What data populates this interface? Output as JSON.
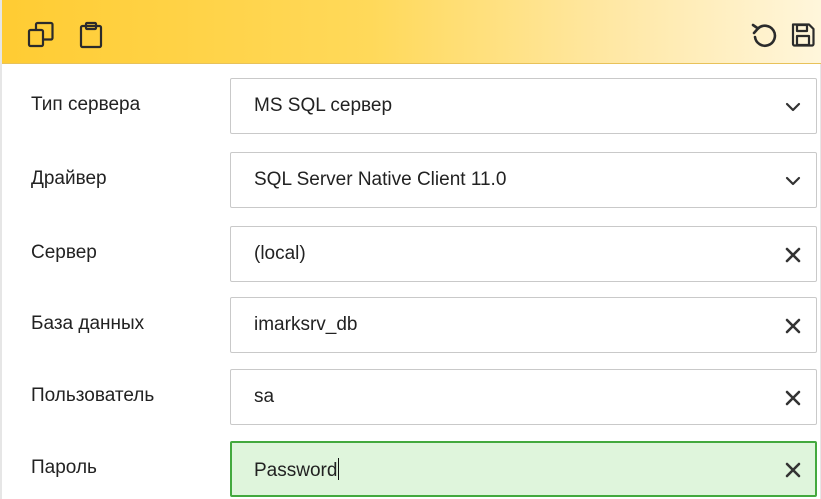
{
  "toolbar": {
    "left_icons": [
      "copy-icon",
      "paste-icon"
    ],
    "right_icons": [
      "undo-icon",
      "save-icon"
    ],
    "accent": "#ffcc33"
  },
  "fields": [
    {
      "label": "Тип сервера",
      "value": "MS SQL сервер",
      "control": "dropdown"
    },
    {
      "label": "Драйвер",
      "value": "SQL Server Native Client 11.0",
      "control": "dropdown"
    },
    {
      "label": "Сервер",
      "value": "(local)",
      "control": "clearable"
    },
    {
      "label": "База данных",
      "value": "imarksrv_db",
      "control": "clearable"
    },
    {
      "label": "Пользователь",
      "value": "sa",
      "control": "clearable"
    },
    {
      "label": "Пароль",
      "value": "Password",
      "control": "clearable",
      "focused": true
    }
  ],
  "colors": {
    "focused_border": "#43a93e",
    "focused_background": "#dff5dc"
  }
}
